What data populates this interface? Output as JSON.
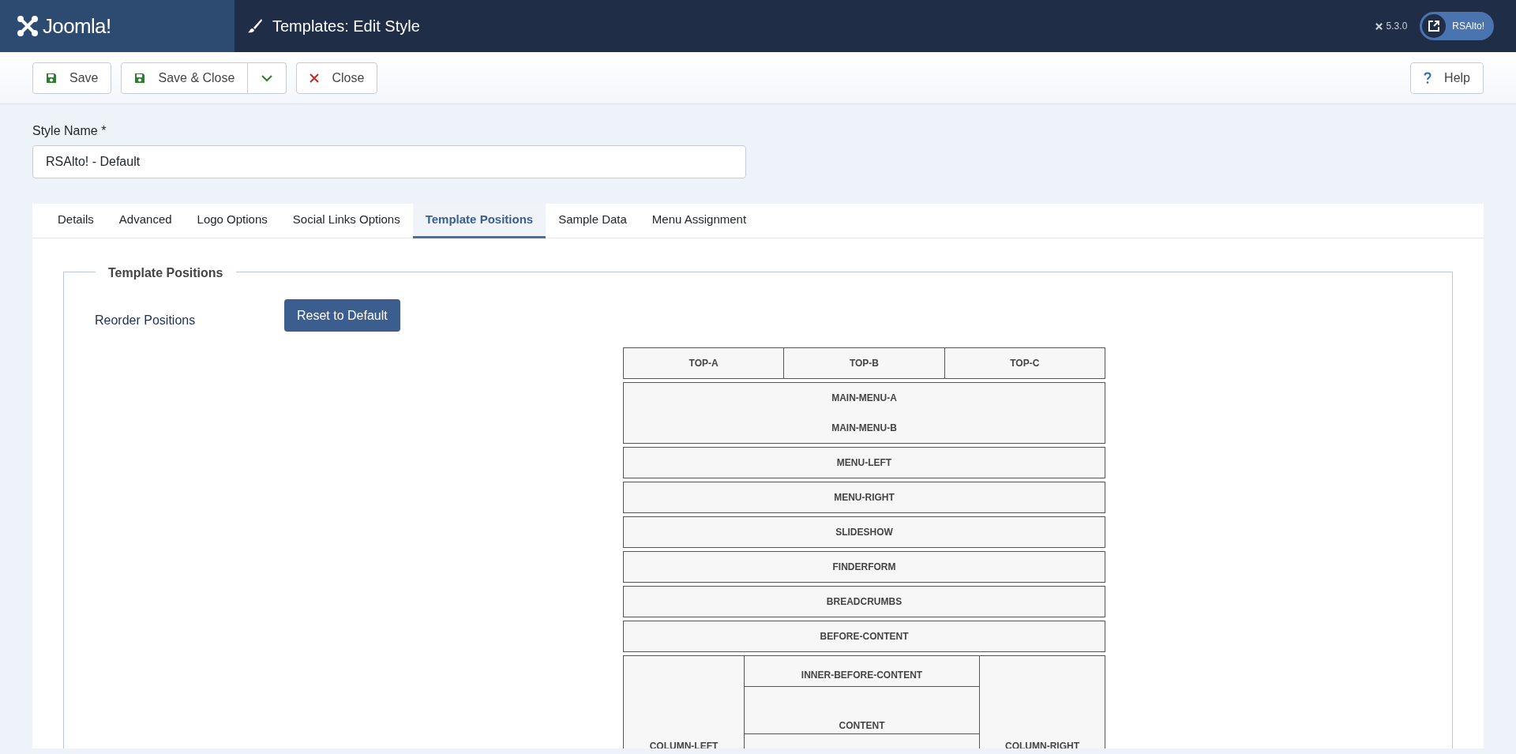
{
  "header": {
    "logo": "Joomla!",
    "title": "Templates: Edit Style",
    "version": "5.3.0",
    "site_button": "RSAlto!"
  },
  "toolbar": {
    "buttons": [
      {
        "kind": "save",
        "label": "Save"
      },
      {
        "kind": "save",
        "label": "Save & Close",
        "dropdown": true
      },
      {
        "kind": "close",
        "label": "Close"
      }
    ],
    "help": "Help"
  },
  "style_name": {
    "label": "Style Name *",
    "value": "RSAlto! - Default"
  },
  "tabs": [
    {
      "label": "Details",
      "selected": false
    },
    {
      "label": "Advanced",
      "selected": false
    },
    {
      "label": "Logo Options",
      "selected": false
    },
    {
      "label": "Social Links Options",
      "selected": false
    },
    {
      "label": "Template Positions",
      "selected": true
    },
    {
      "label": "Sample Data",
      "selected": false
    },
    {
      "label": "Menu Assignment",
      "selected": false
    }
  ],
  "fieldset": {
    "legend": "Template Positions",
    "reorder_label": "Reorder Positions",
    "reset_button": "Reset to Default"
  },
  "positions": [
    {
      "kind": "split",
      "cells": [
        "TOP-A",
        "TOP-B",
        "TOP-C"
      ]
    },
    {
      "kind": "stack",
      "cells": [
        "MAIN-MENU-A",
        "MAIN-MENU-B"
      ]
    },
    {
      "kind": "single",
      "cells": [
        "MENU-LEFT"
      ]
    },
    {
      "kind": "single",
      "cells": [
        "MENU-RIGHT"
      ]
    },
    {
      "kind": "single",
      "cells": [
        "SLIDESHOW"
      ]
    },
    {
      "kind": "single",
      "cells": [
        "FINDERFORM"
      ]
    },
    {
      "kind": "single",
      "cells": [
        "BREADCRUMBS"
      ]
    },
    {
      "kind": "single",
      "cells": [
        "BEFORE-CONTENT"
      ]
    },
    {
      "kind": "columns",
      "left": "COLUMN-LEFT",
      "center": [
        "INNER-BEFORE-CONTENT",
        "CONTENT"
      ],
      "right": "COLUMN-RIGHT"
    }
  ]
}
